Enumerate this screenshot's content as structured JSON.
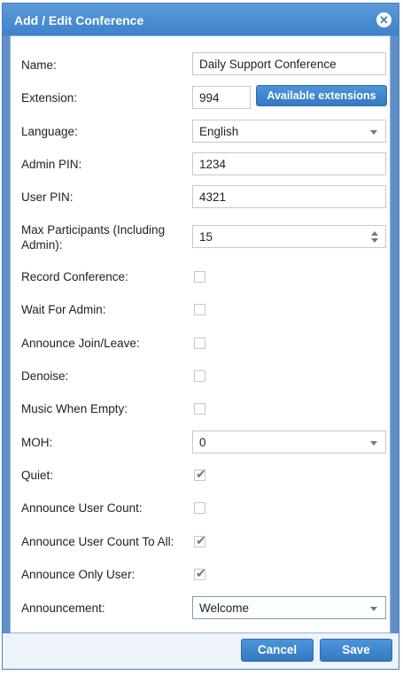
{
  "dialog": {
    "title": "Add / Edit Conference",
    "close_icon": "close-icon"
  },
  "form": {
    "name": {
      "label": "Name:",
      "value": "Daily Support Conference"
    },
    "extension": {
      "label": "Extension:",
      "value": "994",
      "button_label": "Available extensions"
    },
    "language": {
      "label": "Language:",
      "value": "English"
    },
    "admin_pin": {
      "label": "Admin PIN:",
      "value": "1234"
    },
    "user_pin": {
      "label": "User PIN:",
      "value": "4321"
    },
    "max_participants": {
      "label_line1": "Max Participants (Including",
      "label_line2": "Admin):",
      "value": "15"
    },
    "record_conference": {
      "label": "Record Conference:",
      "checked": false
    },
    "wait_for_admin": {
      "label": "Wait For Admin:",
      "checked": false
    },
    "announce_join_leave": {
      "label": "Announce Join/Leave:",
      "checked": false
    },
    "denoise": {
      "label": "Denoise:",
      "checked": false
    },
    "music_when_empty": {
      "label": "Music When Empty:",
      "checked": false
    },
    "moh": {
      "label": "MOH:",
      "value": "0"
    },
    "quiet": {
      "label": "Quiet:",
      "checked": true
    },
    "announce_user_count": {
      "label": "Announce User Count:",
      "checked": false
    },
    "announce_user_count_to_all": {
      "label": "Announce User Count To All:",
      "checked": true
    },
    "announce_only_user": {
      "label": "Announce Only User:",
      "checked": true
    },
    "announcement": {
      "label": "Announcement:",
      "value": "Welcome"
    }
  },
  "footer": {
    "cancel_label": "Cancel",
    "save_label": "Save"
  },
  "colors": {
    "title_bar": "#3e82cb",
    "button": "#3479c2"
  }
}
